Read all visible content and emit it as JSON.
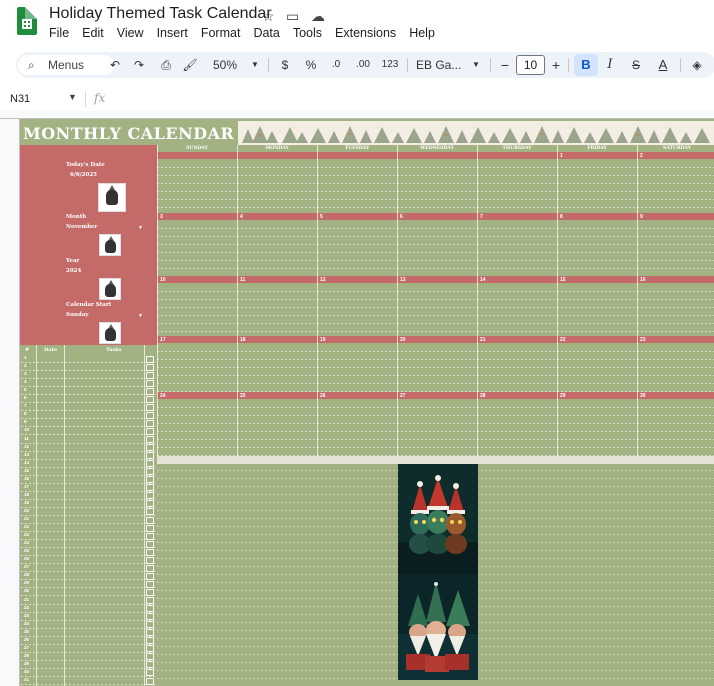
{
  "document": {
    "title": "Holiday Themed Task Calendar",
    "menu": [
      "File",
      "Edit",
      "View",
      "Insert",
      "Format",
      "Data",
      "Tools",
      "Extensions",
      "Help"
    ]
  },
  "toolbar": {
    "search_label": "Menus",
    "zoom": "50%",
    "currency": "$",
    "percent": "%",
    "dec_decrease": ".0",
    "dec_increase": ".00",
    "number_format": "123",
    "font": "EB Ga...",
    "font_size": "10",
    "bold": "B",
    "italic": "I",
    "strike": "S",
    "text_color": "A",
    "minus": "−",
    "plus": "+"
  },
  "formula_bar": {
    "cell_ref": "N31",
    "fx": "fx",
    "content": ""
  },
  "sheet": {
    "title": "MONTHLY CALENDAR",
    "todays_date_label": "Today's Date",
    "todays_date_value": "6/6/2025",
    "month_label": "Month",
    "month_value": "November",
    "year_label": "Year",
    "year_value": "2024",
    "calendar_start_label": "Calendar Start",
    "calendar_start_value": "Sunday",
    "task_headers": {
      "num": "#",
      "date": "Date",
      "tasks": "Tasks"
    },
    "days": [
      "SUNDAY",
      "MONDAY",
      "TUESDAY",
      "WEDNESDAY",
      "THURSDAY",
      "FRIDAY",
      "SATURDAY"
    ],
    "weeks": [
      [
        "",
        "",
        "",
        "",
        "",
        "1",
        "2"
      ],
      [
        "3",
        "4",
        "5",
        "6",
        "7",
        "8",
        "9"
      ],
      [
        "10",
        "11",
        "12",
        "13",
        "14",
        "15",
        "16"
      ],
      [
        "17",
        "18",
        "19",
        "20",
        "21",
        "22",
        "23"
      ],
      [
        "24",
        "25",
        "26",
        "27",
        "28",
        "29",
        "30"
      ]
    ],
    "task_numbers": [
      "1",
      "2",
      "3",
      "4",
      "5",
      "6",
      "7",
      "8",
      "9",
      "10",
      "11",
      "12",
      "13",
      "14",
      "15",
      "16",
      "17",
      "18",
      "19",
      "20",
      "21",
      "22",
      "23",
      "24",
      "25",
      "26",
      "27",
      "28",
      "29",
      "30",
      "31",
      "32",
      "33",
      "34",
      "35",
      "36",
      "37",
      "38",
      "39",
      "40",
      "41"
    ]
  },
  "colors": {
    "sage": "#a3b283",
    "rose": "#c46a68",
    "cream": "#f3ede4",
    "accent_blue": "#0b57d0",
    "sheets_green": "#1e8e3e"
  },
  "icons": [
    "star-icon",
    "move-folder-icon",
    "cloud-icon",
    "search-icon",
    "undo-icon",
    "redo-icon",
    "print-icon",
    "paint-format-icon",
    "fill-color-icon",
    "dropdown-arrow-icon"
  ]
}
